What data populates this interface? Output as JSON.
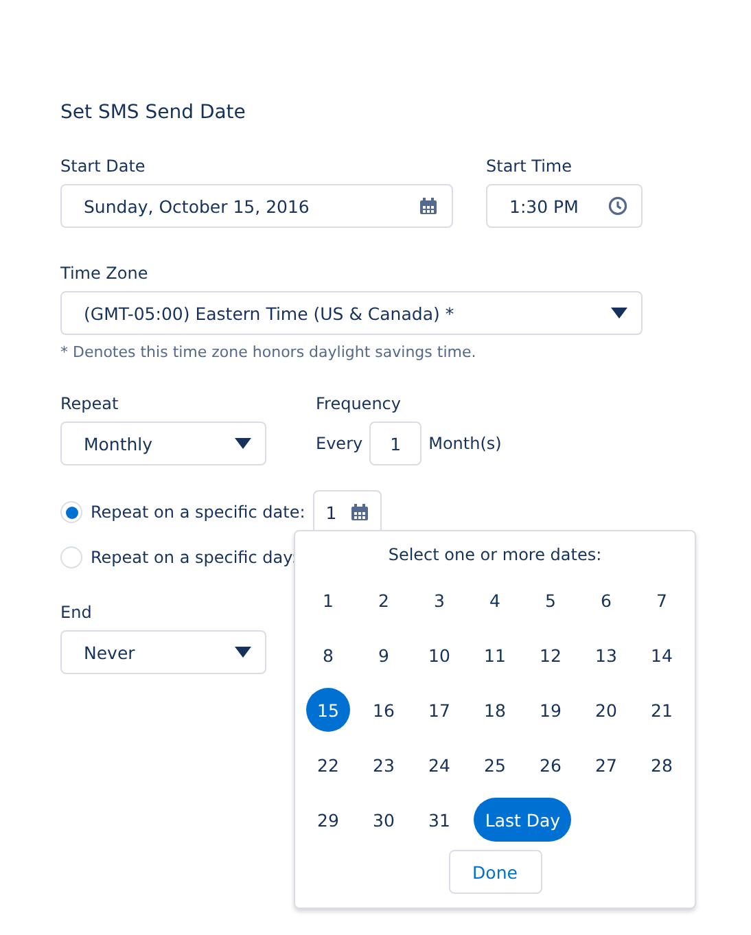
{
  "title": "Set SMS Send Date",
  "start_date": {
    "label": "Start Date",
    "value": "Sunday, October 15, 2016"
  },
  "start_time": {
    "label": "Start Time",
    "value": "1:30 PM"
  },
  "time_zone": {
    "label": "Time Zone",
    "value": "(GMT-05:00) Eastern Time (US & Canada) *",
    "note": "* Denotes this time zone honors daylight savings time."
  },
  "repeat": {
    "label": "Repeat",
    "value": "Monthly"
  },
  "frequency": {
    "label": "Frequency",
    "prefix": "Every",
    "value": "1",
    "suffix": "Month(s)"
  },
  "repeat_options": [
    {
      "label": "Repeat on a specific date:",
      "selected": true,
      "value": "1"
    },
    {
      "label": "Repeat on a specific day:",
      "selected": false
    }
  ],
  "end": {
    "label": "End",
    "value": "Never"
  },
  "date_picker": {
    "heading": "Select one or more dates:",
    "days": [
      {
        "label": "1",
        "selected": false
      },
      {
        "label": "2",
        "selected": false
      },
      {
        "label": "3",
        "selected": false
      },
      {
        "label": "4",
        "selected": false
      },
      {
        "label": "5",
        "selected": false
      },
      {
        "label": "6",
        "selected": false
      },
      {
        "label": "7",
        "selected": false
      },
      {
        "label": "8",
        "selected": false
      },
      {
        "label": "9",
        "selected": false
      },
      {
        "label": "10",
        "selected": false
      },
      {
        "label": "11",
        "selected": false
      },
      {
        "label": "12",
        "selected": false
      },
      {
        "label": "13",
        "selected": false
      },
      {
        "label": "14",
        "selected": false
      },
      {
        "label": "15",
        "selected": true
      },
      {
        "label": "16",
        "selected": false
      },
      {
        "label": "17",
        "selected": false
      },
      {
        "label": "18",
        "selected": false
      },
      {
        "label": "19",
        "selected": false
      },
      {
        "label": "20",
        "selected": false
      },
      {
        "label": "21",
        "selected": false
      },
      {
        "label": "22",
        "selected": false
      },
      {
        "label": "23",
        "selected": false
      },
      {
        "label": "24",
        "selected": false
      },
      {
        "label": "25",
        "selected": false
      },
      {
        "label": "26",
        "selected": false
      },
      {
        "label": "27",
        "selected": false
      },
      {
        "label": "28",
        "selected": false
      },
      {
        "label": "29",
        "selected": false
      },
      {
        "label": "30",
        "selected": false
      },
      {
        "label": "31",
        "selected": false
      }
    ],
    "last_day": {
      "label": "Last Day",
      "selected": true
    },
    "done": "Done"
  }
}
